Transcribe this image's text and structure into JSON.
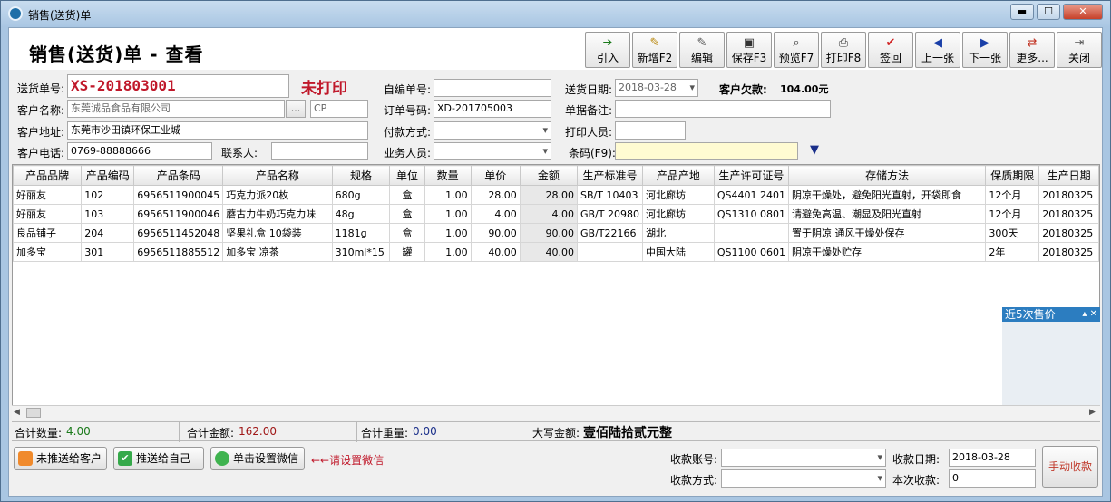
{
  "window": {
    "title": "销售(送货)单",
    "minimize": "▬",
    "maximize": "☐",
    "close": "✕"
  },
  "header": {
    "title": "销售(送货)单 - 查看"
  },
  "toolbar": [
    {
      "label": "引入",
      "icon": "➔",
      "color": "#1a7a1a"
    },
    {
      "label": "新增F2",
      "icon": "✎",
      "color": "#b8860b"
    },
    {
      "label": "编辑",
      "icon": "✎",
      "color": "#555555"
    },
    {
      "label": "保存F3",
      "icon": "▣",
      "color": "#333333"
    },
    {
      "label": "预览F7",
      "icon": "⌕",
      "color": "#333333"
    },
    {
      "label": "打印F8",
      "icon": "⎙",
      "color": "#333333"
    },
    {
      "label": "签回",
      "icon": "✔",
      "color": "#d02020"
    },
    {
      "label": "上一张",
      "icon": "◀",
      "color": "#1a3fa8"
    },
    {
      "label": "下一张",
      "icon": "▶",
      "color": "#1a3fa8"
    },
    {
      "label": "更多...",
      "icon": "⇄",
      "color": "#c03020"
    },
    {
      "label": "关闭",
      "icon": "⇥",
      "color": "#555555"
    }
  ],
  "form": {
    "delivery_no_label": "送货单号:",
    "delivery_no": "XS-201803001",
    "print_status": "未打印",
    "self_no_label": "自编单号:",
    "self_no": "",
    "delivery_date_label": "送货日期:",
    "delivery_date": "2018-03-28",
    "debt_label": "客户欠款:",
    "debt_value": "104.00元",
    "customer_label": "客户名称:",
    "customer": "东莞诚品食品有限公司",
    "customer_browse": "...",
    "customer_code": "CP",
    "order_no_label": "订单号码:",
    "order_no": "XD-201705003",
    "remark_label": "单据备注:",
    "remark": "",
    "address_label": "客户地址:",
    "address": "东莞市沙田镇环保工业城",
    "payment_label": "付款方式:",
    "payment": "",
    "printer_label": "打印人员:",
    "printer": "",
    "phone_label": "客户电话:",
    "phone": "0769-88888666",
    "contact_label": "联系人:",
    "contact": "",
    "salesman_label": "业务人员:",
    "salesman": "",
    "barcode_label": "条码(F9):",
    "barcode": "",
    "barcode_arrow": "▼"
  },
  "table": {
    "columns": [
      "产品品牌",
      "产品编码",
      "产品条码",
      "产品名称",
      "规格",
      "单位",
      "数量",
      "单价",
      "金额",
      "生产标准号",
      "产品产地",
      "生产许可证号",
      "存储方法",
      "保质期限",
      "生产日期"
    ],
    "rows": [
      [
        "好丽友",
        "102",
        "6956511900045",
        "巧克力派20枚",
        "680g",
        "盒",
        "1.00",
        "28.00",
        "28.00",
        "SB/T 10403",
        "河北廊坊",
        "QS4401 2401",
        "阴凉干燥处，避免阳光直射，开袋即食",
        "12个月",
        "20180325"
      ],
      [
        "好丽友",
        "103",
        "6956511900046",
        "蘑古力牛奶巧克力味",
        "48g",
        "盒",
        "1.00",
        "4.00",
        "4.00",
        "GB/T 20980",
        "河北廊坊",
        "QS1310 0801",
        "请避免高温、潮显及阳光直射",
        "12个月",
        "20180325"
      ],
      [
        "良品铺子",
        "204",
        "6956511452048",
        "坚果礼盒 10袋装",
        "1181g",
        "盒",
        "1.00",
        "90.00",
        "90.00",
        "GB/T22166",
        "湖北",
        "",
        "置于阴凉 通风干燥处保存",
        "300天",
        "20180325"
      ],
      [
        "加多宝",
        "301",
        "6956511885512",
        "加多宝 凉茶",
        "310ml*15",
        "罐",
        "1.00",
        "40.00",
        "40.00",
        "",
        "中国大陆",
        "QS1100 0601",
        "阴凉干燥处贮存",
        "2年",
        "20180325"
      ]
    ]
  },
  "side_panel": {
    "title": "近5次售价",
    "controls": "▴ ✕"
  },
  "summary": {
    "qty_label": "合计数量:",
    "qty": "4.00",
    "amount_label": "合计金额:",
    "amount": "162.00",
    "weight_label": "合计重量:",
    "weight": "0.00",
    "capital_label": "大写金额:",
    "capital": "壹佰陆拾贰元整"
  },
  "bottom": {
    "push_customer": "未推送给客户",
    "push_self": "推送给自己",
    "wechat_setup": "单击设置微信",
    "wechat_hint": "←←请设置微信",
    "account_label": "收款账号:",
    "account": "",
    "receipt_date_label": "收款日期:",
    "receipt_date": "2018-03-28",
    "method_label": "收款方式:",
    "method": "",
    "this_receipt_label": "本次收款:",
    "this_receipt": "0",
    "manual_receipt": "手动收款"
  }
}
